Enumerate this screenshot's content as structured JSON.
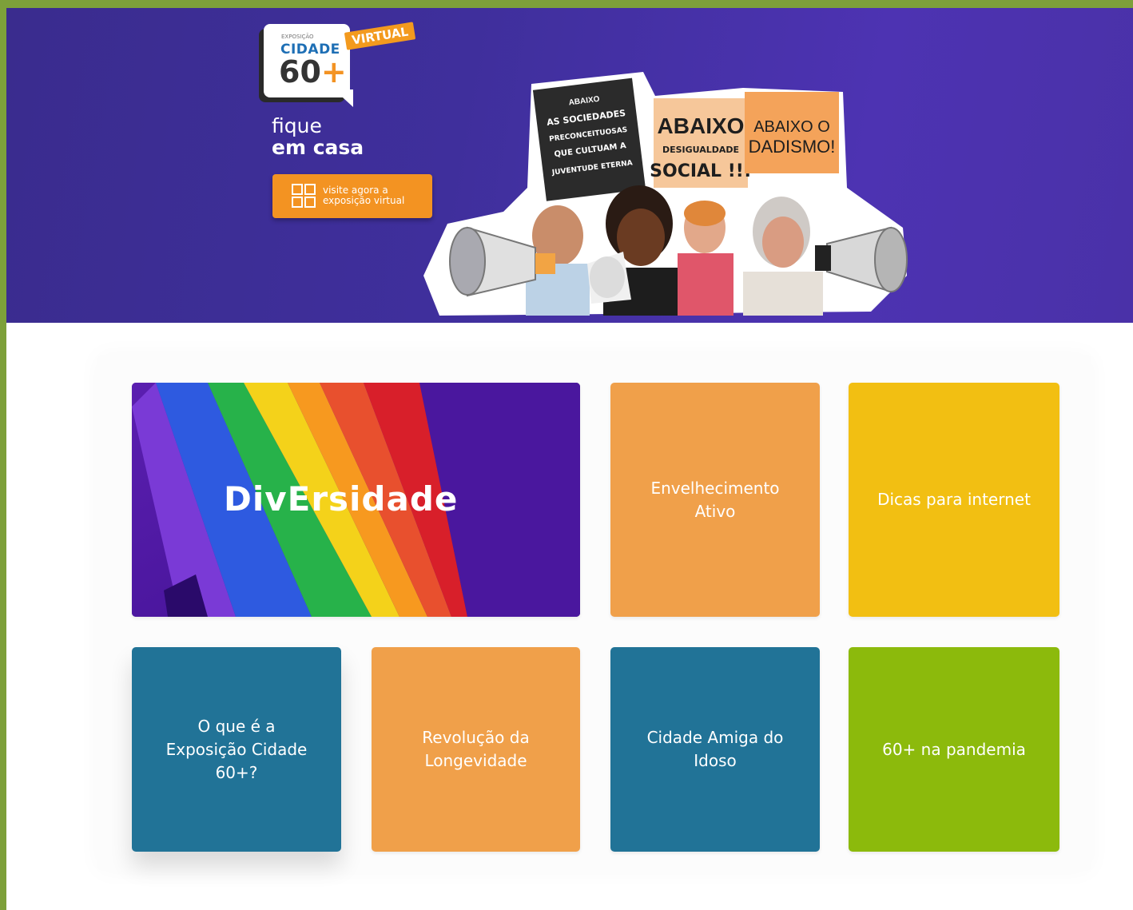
{
  "hero": {
    "logo": {
      "small_label": "EXPOSIÇÃO",
      "name": "CIDADE",
      "number": "60",
      "plus": "+",
      "badge": "VIRTUAL"
    },
    "tagline_line1": "fique",
    "tagline_line2": "em casa",
    "cta_label": "visite agora a exposição virtual",
    "signs": [
      "ABAIXO AS SOCIEDADES PRECONCEITUOSAS QUE CULTUAM A JUVENTUDE ETERNA",
      "ABAIXO",
      "DESIGUALDADE",
      "SOCIAL !!!",
      "ABAIXO O DADISMO!"
    ]
  },
  "tiles": {
    "feature_label": "DivErsidade",
    "envelhecimento": "Envelhecimento Ativo",
    "dicas": "Dicas para internet",
    "oque": "O que é a Exposição Cidade 60+?",
    "revolucao": "Revolução da Longevidade",
    "cidade_amiga": "Cidade Amiga do Idoso",
    "pandemia": "60+ na pandemia"
  },
  "colors": {
    "hero_purple": "#3f2f9c",
    "orange": "#f0a04a",
    "yellow": "#f2bf12",
    "blue": "#217397",
    "green": "#8cba0c",
    "frame": "#7da03a"
  }
}
